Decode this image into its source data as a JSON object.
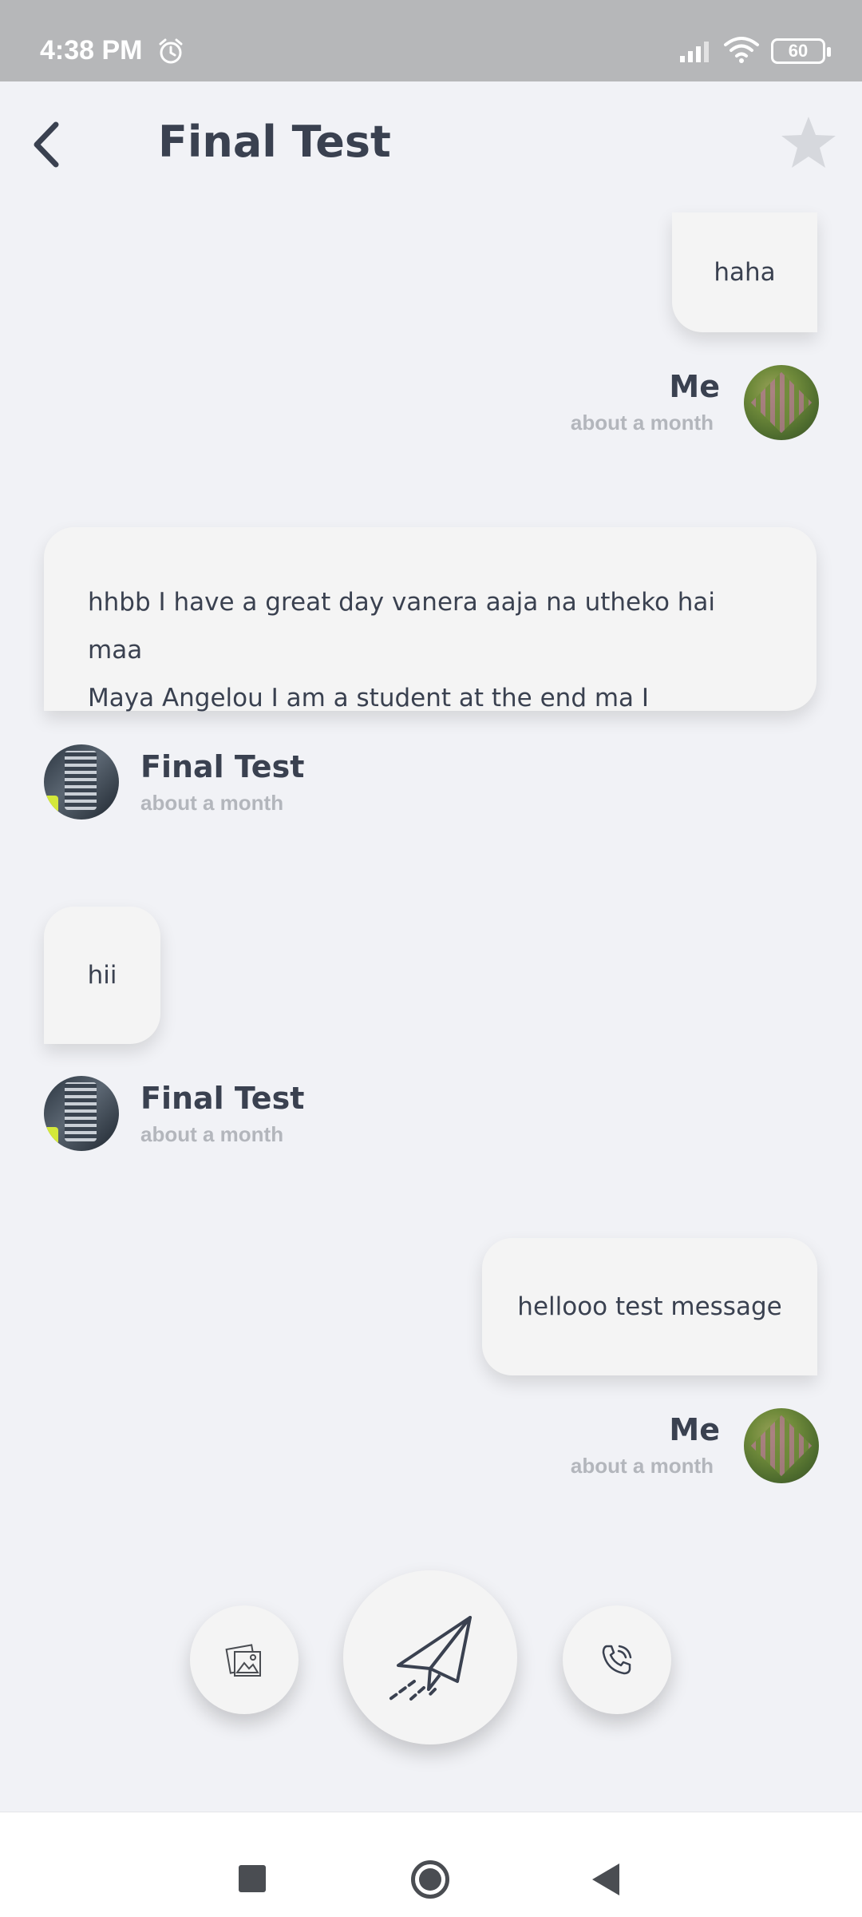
{
  "status_bar": {
    "time": "4:38 PM",
    "battery": "60",
    "icons": [
      "alarm-icon",
      "signal-icon",
      "wifi-icon",
      "battery-icon"
    ]
  },
  "header": {
    "title": "Final Test",
    "back_icon": "chevron-left-icon",
    "star_icon": "star-icon"
  },
  "messages": [
    {
      "from": "me",
      "text": "haha",
      "sender": "Me",
      "time": "about a month"
    },
    {
      "from": "them",
      "text_lines": [
        "hhbb I have a great day vanera aaja na utheko hai maa",
        "Maya Angelou I am a student at the end ma I"
      ],
      "sender": "Final Test",
      "time": "about a month"
    },
    {
      "from": "them",
      "text": "hii",
      "sender": "Final Test",
      "time": "about a month"
    },
    {
      "from": "me",
      "text": "hellooo test message",
      "sender": "Me",
      "time": "about a month"
    }
  ],
  "actions": {
    "gallery_icon": "image-gallery-icon",
    "send_icon": "paper-plane-icon",
    "call_icon": "phone-call-icon"
  },
  "nav_bar": {
    "icons": [
      "recents-square-icon",
      "home-circle-icon",
      "back-triangle-icon"
    ]
  },
  "colors": {
    "background": "#f1f2f6",
    "bubble": "#f4f4f4",
    "text": "#3a4150",
    "muted": "#b3b6bc",
    "status_bar": "#b6b7b9"
  }
}
